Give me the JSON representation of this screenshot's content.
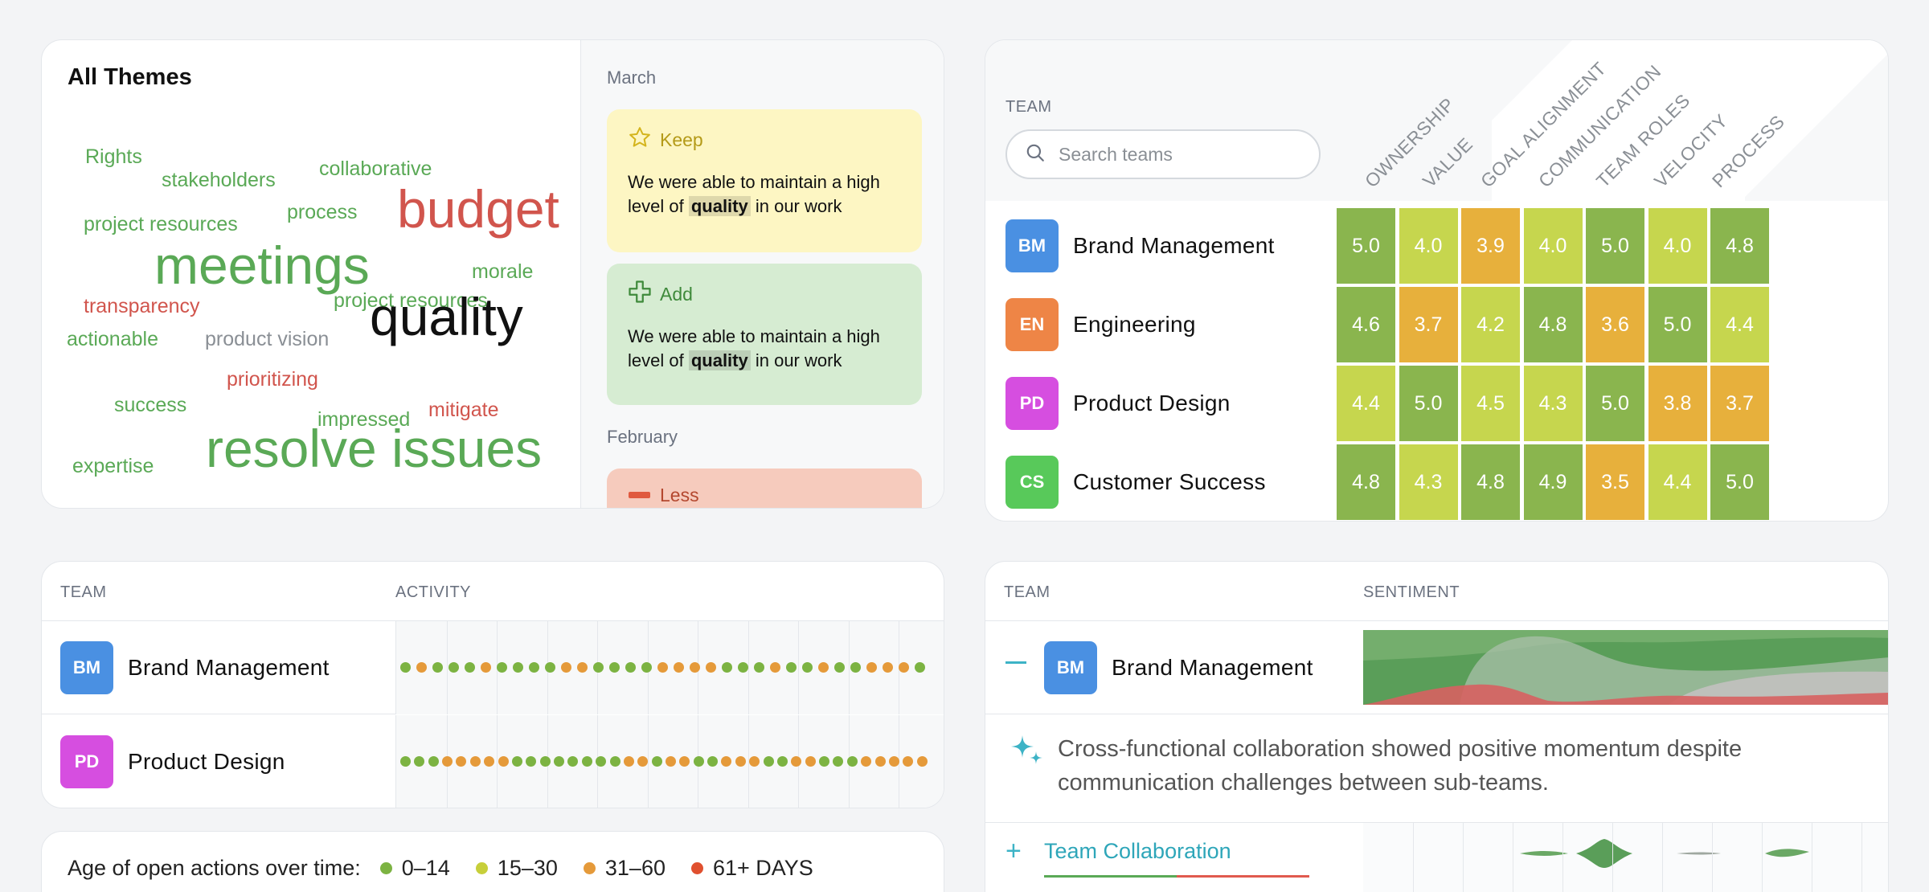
{
  "themes": {
    "title": "All Themes",
    "words": [
      {
        "text": "Rights",
        "color": "green",
        "size": 25
      },
      {
        "text": "stakeholders",
        "color": "green",
        "size": 25
      },
      {
        "text": "collaborative",
        "color": "green",
        "size": 25
      },
      {
        "text": "project resources",
        "color": "green",
        "size": 25
      },
      {
        "text": "process",
        "color": "green",
        "size": 25
      },
      {
        "text": "budget",
        "color": "red",
        "size": 66
      },
      {
        "text": "meetings",
        "color": "green",
        "size": 66
      },
      {
        "text": "morale",
        "color": "green",
        "size": 25
      },
      {
        "text": "transparency",
        "color": "red",
        "size": 25
      },
      {
        "text": "project resources",
        "color": "green",
        "size": 25
      },
      {
        "text": "actionable",
        "color": "green",
        "size": 25
      },
      {
        "text": "product vision",
        "color": "gray",
        "size": 25
      },
      {
        "text": "quality",
        "color": "black",
        "size": 66
      },
      {
        "text": "prioritizing",
        "color": "red",
        "size": 25
      },
      {
        "text": "success",
        "color": "green",
        "size": 25
      },
      {
        "text": "impressed",
        "color": "green",
        "size": 25
      },
      {
        "text": "mitigate",
        "color": "red",
        "size": 25
      },
      {
        "text": "expertise",
        "color": "green",
        "size": 25
      },
      {
        "text": "resolve issues",
        "color": "green",
        "size": 66
      }
    ],
    "feedback": {
      "march_label": "March",
      "february_label": "February",
      "keep": {
        "label": "Keep",
        "before": "We were able to maintain a high level of ",
        "highlight": "quality",
        "after": " in our work"
      },
      "add": {
        "label": "Add",
        "before": "We were able to maintain a high level of ",
        "highlight": "quality",
        "after": " in our work"
      },
      "less": {
        "label": "Less"
      }
    }
  },
  "heatmap": {
    "team_header": "TEAM",
    "search_placeholder": "Search teams",
    "columns": [
      "OWNERSHIP",
      "VALUE",
      "GOAL ALIGNMENT",
      "COMMUNICATION",
      "TEAM ROLES",
      "VELOCITY",
      "PROCESS"
    ],
    "rows": [
      {
        "initials": "BM",
        "name": "Brand Management",
        "color": "#4a90e2",
        "values": [
          "5.0",
          "4.0",
          "3.9",
          "4.0",
          "5.0",
          "4.0",
          "4.8"
        ]
      },
      {
        "initials": "EN",
        "name": "Engineering",
        "color": "#ee8546",
        "values": [
          "4.6",
          "3.7",
          "4.2",
          "4.8",
          "3.6",
          "5.0",
          "4.4"
        ]
      },
      {
        "initials": "PD",
        "name": "Product Design",
        "color": "#d64ee0",
        "values": [
          "4.4",
          "5.0",
          "4.5",
          "4.3",
          "5.0",
          "3.8",
          "3.7"
        ]
      },
      {
        "initials": "CS",
        "name": "Customer Success",
        "color": "#58c95a",
        "values": [
          "4.8",
          "4.3",
          "4.8",
          "4.9",
          "3.5",
          "4.4",
          "5.0"
        ]
      }
    ],
    "scale_colors": {
      "high": "#8ab54e",
      "mid": "#c6d64e",
      "low": "#e7b03c"
    }
  },
  "activity": {
    "team_header": "TEAM",
    "activity_header": "ACTIVITY",
    "rows": [
      {
        "initials": "BM",
        "name": "Brand Management",
        "color": "#4a90e2",
        "dots": [
          "g",
          "o",
          "g",
          "g",
          "g",
          "o",
          "g",
          "g",
          "g",
          "g",
          "o",
          "o",
          "g",
          "g",
          "g",
          "g",
          "o",
          "o",
          "o",
          "o",
          "g",
          "g",
          "g",
          "o",
          "g",
          "g",
          "o",
          "g",
          "g",
          "o",
          "o",
          "o",
          "g"
        ]
      },
      {
        "initials": "PD",
        "name": "Product Design",
        "color": "#d64ee0",
        "dots": [
          "g",
          "g",
          "g",
          "o",
          "o",
          "o",
          "o",
          "o",
          "g",
          "g",
          "g",
          "g",
          "g",
          "g",
          "g",
          "g",
          "o",
          "o",
          "g",
          "o",
          "o",
          "g",
          "g",
          "o",
          "o",
          "o",
          "g",
          "g",
          "o",
          "o",
          "g",
          "g",
          "g",
          "o",
          "o",
          "o",
          "o",
          "o"
        ]
      }
    ]
  },
  "legend": {
    "label": "Age of open actions over time:",
    "items": [
      {
        "text": "0–14",
        "color": "#7cb342"
      },
      {
        "text": "15–30",
        "color": "#c7cf3a"
      },
      {
        "text": "31–60",
        "color": "#e59a3a"
      },
      {
        "text": "61+ DAYS",
        "color": "#e0502f"
      }
    ]
  },
  "sentiment": {
    "team_header": "TEAM",
    "sentiment_header": "SENTIMENT",
    "row": {
      "initials": "BM",
      "name": "Brand Management",
      "color": "#4a90e2"
    },
    "summary": "Cross-functional collaboration showed positive momentum despite communication challenges between sub-teams.",
    "subtheme": "Team Collaboration"
  }
}
